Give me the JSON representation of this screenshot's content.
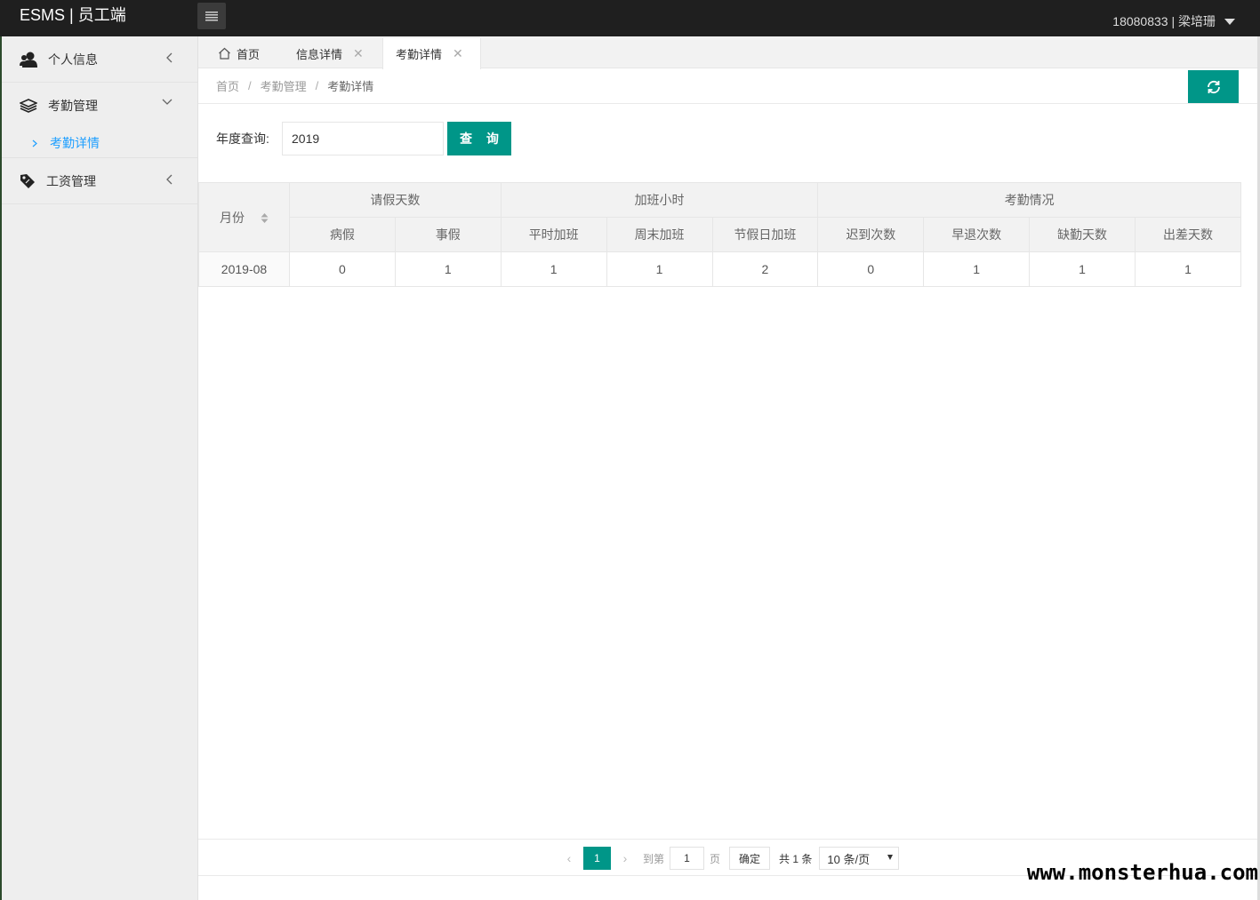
{
  "header": {
    "brand": "ESMS | 员工端",
    "user": "18080833 | 梁培珊"
  },
  "sidebar": {
    "items": [
      {
        "label": "个人信息",
        "icon": "user-icon",
        "expanded": false
      },
      {
        "label": "考勤管理",
        "icon": "layers-icon",
        "expanded": true,
        "children": [
          {
            "label": "考勤详情",
            "active": true
          }
        ]
      },
      {
        "label": "工资管理",
        "icon": "tag-icon",
        "expanded": false
      }
    ]
  },
  "tabs": [
    {
      "label": "首页",
      "icon": "home-icon",
      "closable": false
    },
    {
      "label": "信息详情",
      "closable": true
    },
    {
      "label": "考勤详情",
      "closable": true,
      "active": true
    }
  ],
  "breadcrumb": [
    "首页",
    "考勤管理",
    "考勤详情"
  ],
  "breadcrumb_sep": "/",
  "search": {
    "label": "年度查询:",
    "value": "2019",
    "button": "查 询"
  },
  "table": {
    "month_header": "月份",
    "groups": [
      {
        "label": "请假天数",
        "columns": [
          "病假",
          "事假"
        ]
      },
      {
        "label": "加班小时",
        "columns": [
          "平时加班",
          "周末加班",
          "节假日加班"
        ]
      },
      {
        "label": "考勤情况",
        "columns": [
          "迟到次数",
          "早退次数",
          "缺勤天数",
          "出差天数"
        ]
      }
    ],
    "rows": [
      {
        "month": "2019-08",
        "values": [
          "0",
          "1",
          "1",
          "1",
          "2",
          "0",
          "1",
          "1",
          "1"
        ]
      }
    ]
  },
  "pagination": {
    "current": "1",
    "goto_label": "到第",
    "goto_value": "1",
    "page_label": "页",
    "confirm": "确定",
    "total": "共 1 条",
    "page_size": "10 条/页"
  },
  "watermark": "www.monsterhua.com",
  "colors": {
    "primary": "#009688",
    "topbar": "#1f1f1f",
    "link": "#1e9fff"
  }
}
